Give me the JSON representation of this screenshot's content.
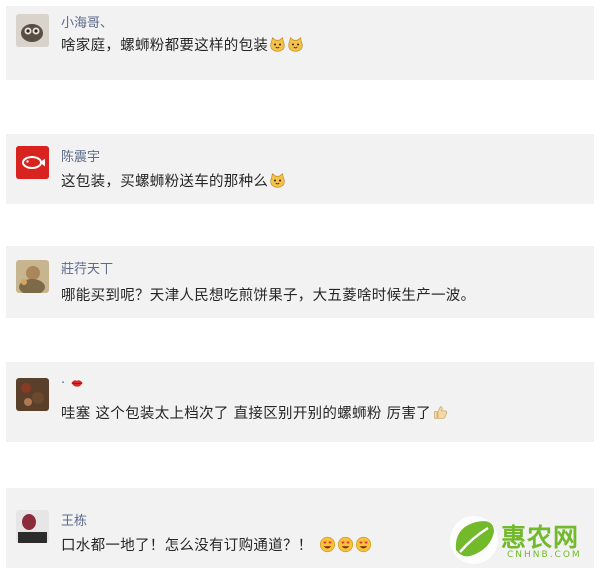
{
  "comments": [
    {
      "username": "小海哥、",
      "text": "啥家庭，螺蛳粉都要这样的包装"
    },
    {
      "username": "陈震宇",
      "text": "这包装，买螺蛳粉送车的那种么"
    },
    {
      "username": "莊荇天丅",
      "text": "哪能买到呢？天津人民想吃煎饼果子，大五菱啥时候生产一波。"
    },
    {
      "username": "·",
      "text": "哇塞 这个包装太上档次了 直接区别开别的螺蛳粉 厉害了"
    },
    {
      "username": "王栋",
      "text": "口水都一地了！怎么没有订购通道？！"
    }
  ],
  "emoji_icons": {
    "cat": "cat-face-icon",
    "lips": "lips-icon",
    "thumbs": "thumbs-up-icon",
    "heart_eyes": "heart-eyes-face-icon"
  },
  "watermark": {
    "title": "惠农网",
    "sub": "CNHNB.COM",
    "color": "#72b92b"
  }
}
